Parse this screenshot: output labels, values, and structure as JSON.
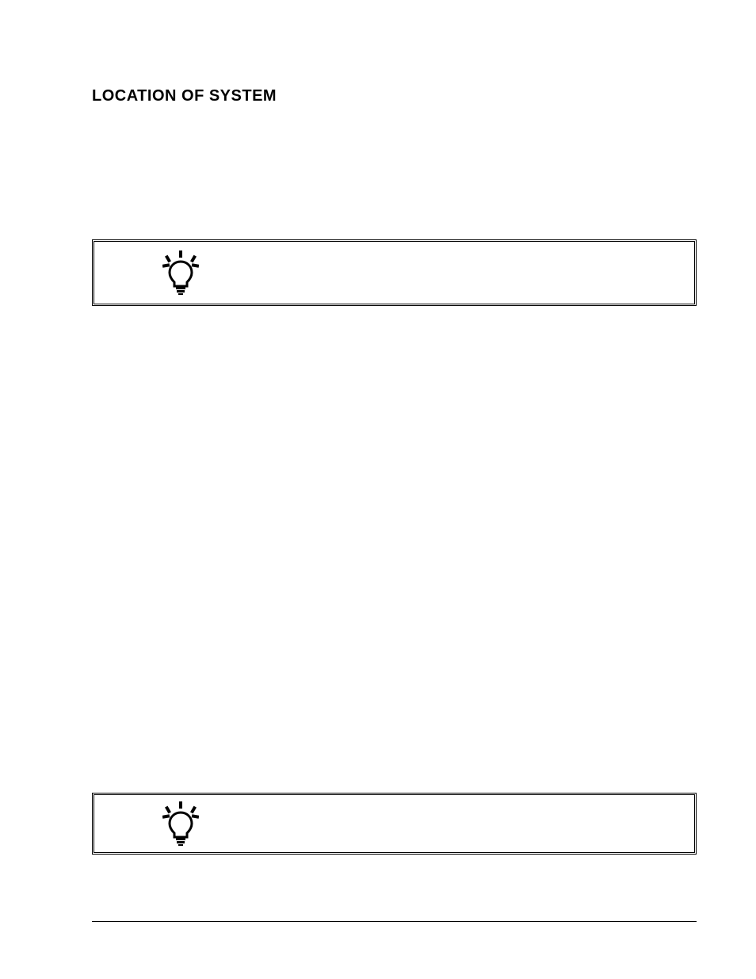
{
  "title": "LOCATION OF SYSTEM",
  "icon_alt_top": "hint-bulb",
  "icon_alt_bottom": "hint-bulb"
}
